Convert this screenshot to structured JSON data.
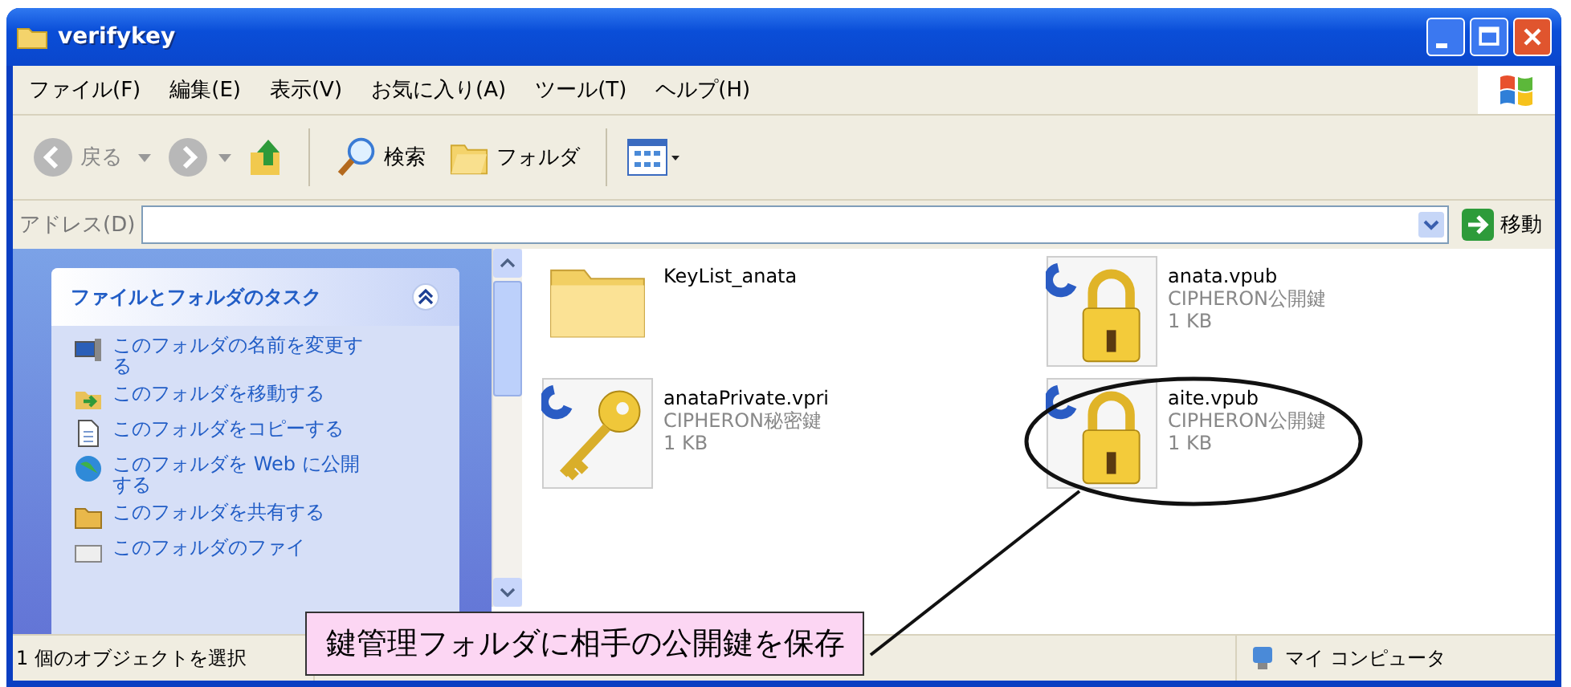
{
  "window": {
    "title": "verifykey"
  },
  "menu": [
    "ファイル(F)",
    "編集(E)",
    "表示(V)",
    "お気に入り(A)",
    "ツール(T)",
    "ヘルプ(H)"
  ],
  "toolbar": {
    "back": {
      "label": "戻る",
      "disabled": true
    },
    "search": "検索",
    "folders": "フォルダ"
  },
  "address": {
    "label": "アドレス(D)",
    "go": "移動"
  },
  "tasks": {
    "title": "ファイルとフォルダのタスク",
    "expanded": true,
    "items": [
      {
        "kind": "rename",
        "label": "このフォルダの名前を変更する"
      },
      {
        "kind": "move",
        "label": "このフォルダを移動する"
      },
      {
        "kind": "copy",
        "label": "このフォルダをコピーする"
      },
      {
        "kind": "web",
        "label": "このフォルダを Web に公開する"
      },
      {
        "kind": "share",
        "label": "このフォルダを共有する"
      },
      {
        "kind": "mail",
        "label": "このフォルダのファイ"
      }
    ]
  },
  "files": [
    {
      "kind": "folder",
      "name": "KeyList_anata"
    },
    {
      "kind": "lock",
      "name": "anata.vpub",
      "type": "CIPHERON公開鍵",
      "size": "1 KB"
    },
    {
      "kind": "key",
      "name": "anataPrivate.vpri",
      "type": "CIPHERON秘密鍵",
      "size": "1 KB"
    },
    {
      "kind": "lock",
      "name": "aite.vpub",
      "type": "CIPHERON公開鍵",
      "size": "1 KB"
    }
  ],
  "status_bar": {
    "selection": "1 個のオブジェクトを選択",
    "location": "マイ コンピュータ"
  },
  "callout": {
    "text": "鍵管理フォルダに相手の公開鍵を保存"
  }
}
